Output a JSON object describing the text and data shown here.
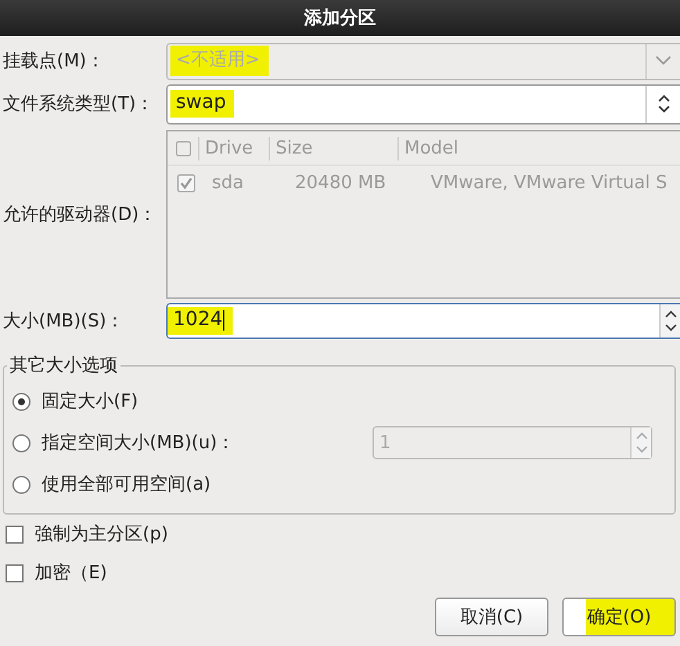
{
  "window": {
    "title": "添加分区"
  },
  "mount_point": {
    "label": "挂载点(M)：",
    "value": "<不适用>",
    "disabled": true,
    "highlighted": true
  },
  "fs_type": {
    "label": "文件系统类型(T)：",
    "value": "swap",
    "highlighted": true
  },
  "drives": {
    "label": "允许的驱动器(D)：",
    "disabled": true,
    "header_checked": false,
    "columns": [
      "Drive",
      "Size",
      "Model"
    ],
    "rows": [
      {
        "checked": true,
        "cells": [
          "sda",
          "20480 MB",
          "VMware, VMware Virtual S"
        ]
      }
    ]
  },
  "size": {
    "label": "大小(MB)(S)：",
    "value": "1024",
    "highlighted": true
  },
  "size_options": {
    "title": "其它大小选项",
    "options": [
      {
        "label": "固定大小(F)",
        "selected": true
      },
      {
        "label": "指定空间大小(MB)(u)：",
        "selected": false,
        "spin_value": "1",
        "spin_disabled": true
      },
      {
        "label": "使用全部可用空间(a)",
        "selected": false
      }
    ]
  },
  "checkboxes": [
    {
      "label": "強制为主分区(p)",
      "checked": false
    },
    {
      "label": "加密（E)",
      "checked": false
    }
  ],
  "buttons": [
    {
      "label": "取消(C)",
      "highlighted": false
    },
    {
      "label": "确定(O)",
      "highlighted": true
    }
  ]
}
